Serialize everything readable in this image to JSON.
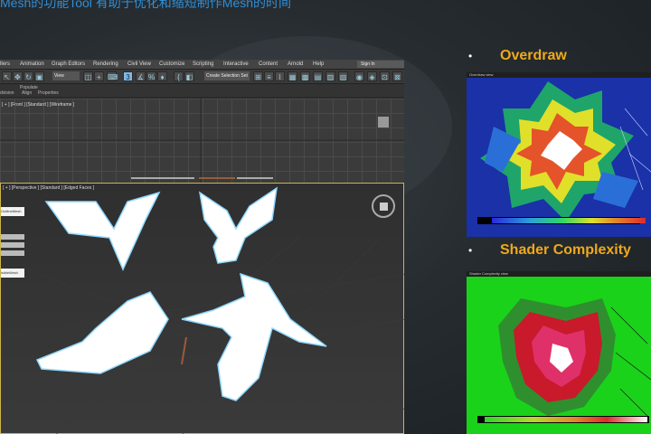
{
  "slide": {
    "title": "Mesh的功能Tool 有助于优化和缩短制作Mesh的时间",
    "bullets": [
      {
        "label": "Overdraw"
      },
      {
        "label": "Shader Complexity"
      }
    ]
  },
  "max": {
    "menu": [
      "llers",
      "Animation",
      "Graph Editors",
      "Rendering",
      "Civil View",
      "Customize",
      "Scripting",
      "Interactive",
      "Content",
      "Arnold",
      "Help"
    ],
    "signin": "Sign In",
    "view_dropdown": "View",
    "selection_set": "Create Selection Set",
    "ribbon": {
      "populate": "Populate",
      "subdivision": "dvision",
      "align": "Align",
      "properties": "Properties"
    },
    "top_viewport_label": "[ + ] [Front ] [Standard ] [Wireframe ]",
    "persp_viewport_label": "[ + ] [Perspective ] [Standard ] [Edged Faces ]",
    "panel": {
      "outline_mesh": "OutlineMesh",
      "visible_mesh": "isibleMesh"
    }
  },
  "overdraw_image": {
    "title_text": "Overdraw view"
  },
  "shader_image": {
    "title_text": "Shader Complexity view"
  },
  "colors": {
    "title_blue": "#2f8fd8",
    "bullet_orange": "#f0a91c",
    "overdraw_bg": "#1a31a8",
    "shader_bg": "#1ad21a",
    "selection_cyan": "#8fd8ff"
  }
}
